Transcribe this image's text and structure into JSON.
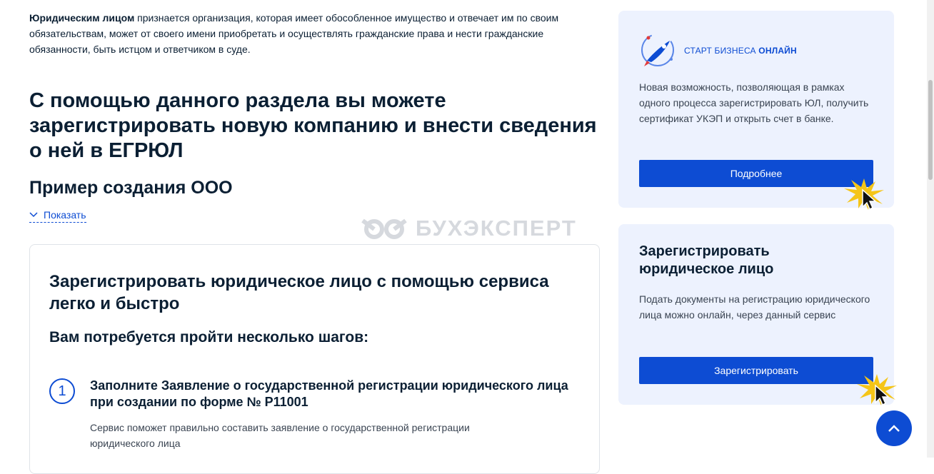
{
  "intro": {
    "bold": "Юридическим лицом",
    "rest": " признается организация, которая имеет обособленное имущество и отвечает им по своим обязательствам, может от своего имени приобретать и осуществлять гражданские права и нести гражданские обязанности, быть истцом и ответчиком в суде."
  },
  "main": {
    "heading": "С помощью данного раздела вы можете зарегистрировать новую компанию и внести сведения о ней в ЕГРЮЛ",
    "example_title": "Пример создания ООО",
    "toggle_label": "Показать",
    "watermark": "БУХЭКСПЕРТ"
  },
  "card": {
    "title": "Зарегистрировать юридическое лицо с помощью сервиса легко и быстро",
    "steps_title": "Вам потребуется пройти несколько шагов:",
    "steps": [
      {
        "number": "1",
        "title": "Заполните Заявление о государственной регистрации юридического лица при создании по форме № Р11001",
        "text": "Сервис поможет правильно составить заявление о государственной регистрации юридического лица"
      }
    ]
  },
  "side1": {
    "logo_text_a": "СТАРТ БИЗНЕСА ",
    "logo_text_b": "ОНЛАЙН",
    "text": "Новая возможность, позволяющая в рамках одного процесса зарегистрировать ЮЛ, получить сертификат УКЭП и открыть счет в банке.",
    "button": "Подробнее"
  },
  "side2": {
    "title": "Зарегистрировать юридическое лицо",
    "text": "Подать документы на регистрацию юридического лица можно онлайн, через данный сервис",
    "button": "Зарегистрировать"
  },
  "colors": {
    "accent": "#0d4cd3",
    "text": "#0b1f33",
    "panel": "#edf2fe"
  }
}
